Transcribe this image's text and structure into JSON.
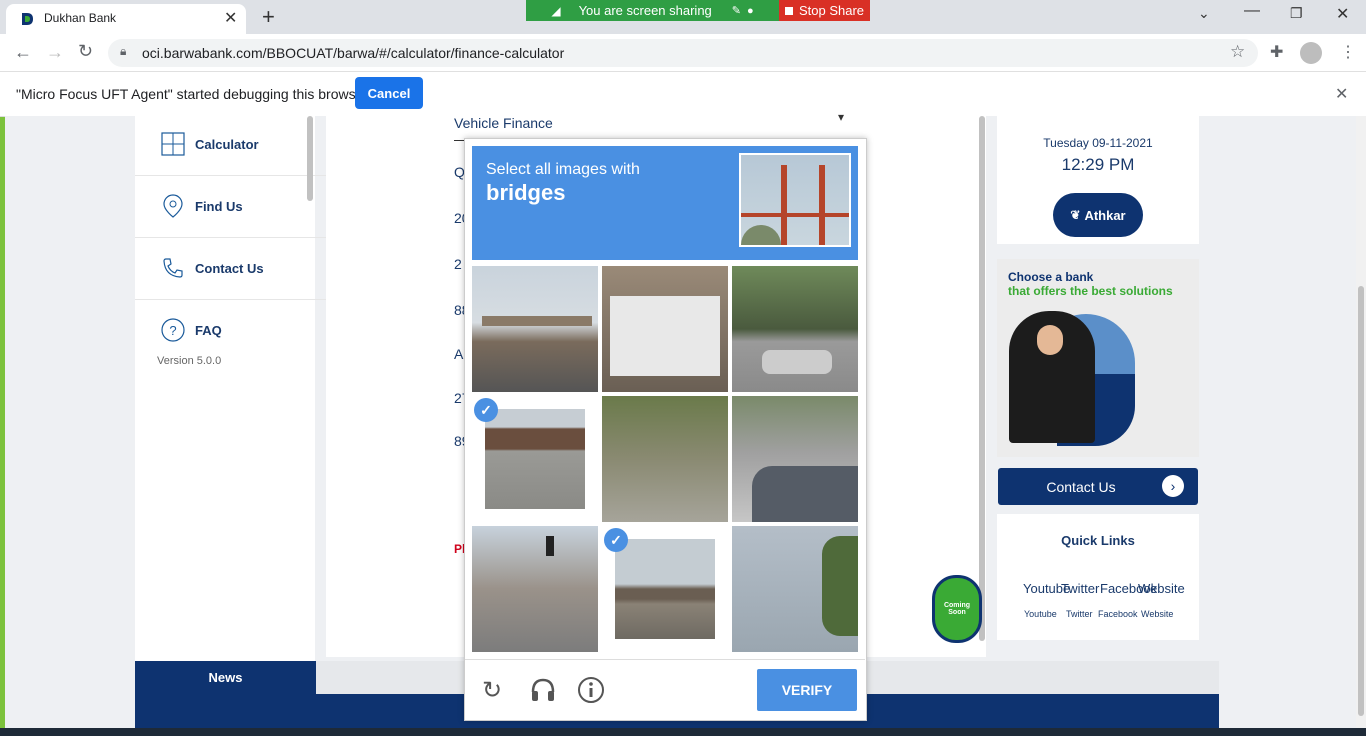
{
  "browser": {
    "tab_title": "Dukhan Bank",
    "url": "oci.barwabank.com/BBOCUAT/barwa/#/calculator/finance-calculator",
    "new_tab": "+"
  },
  "screen_share": {
    "message": "You are screen sharing",
    "stop_label": "Stop Share"
  },
  "infobar": {
    "message": "\"Micro Focus UFT Agent\" started debugging this browser",
    "cancel_label": "Cancel"
  },
  "sidebar": {
    "items": [
      {
        "label": "Calculator"
      },
      {
        "label": "Find Us"
      },
      {
        "label": "Contact Us"
      },
      {
        "label": "FAQ"
      }
    ],
    "version": "Version 5.0.0"
  },
  "form": {
    "finance_type": "Vehicle Finance",
    "partial_values": [
      "Q",
      "20",
      "2",
      "88",
      "A",
      "27",
      "89"
    ],
    "partial_red": "Pl"
  },
  "right_panel": {
    "date": "Tuesday 09-11-2021",
    "time": "12:29 PM",
    "athkar_label": "Athkar",
    "ad_line1": "Choose a bank",
    "ad_line2": "that offers the best solutions",
    "contact_label": "Contact Us",
    "quick_links_title": "Quick Links",
    "links": [
      {
        "alt": "Youtube",
        "label": "Youtube"
      },
      {
        "alt": "Twitter",
        "label": "Twitter"
      },
      {
        "alt": "Facebook",
        "label": "Facebook"
      },
      {
        "alt": "Website",
        "label": "Website"
      }
    ],
    "coming_soon": "Coming Soon"
  },
  "news": {
    "label": "News"
  },
  "captcha": {
    "instruction": "Select all images with",
    "target": "bridges",
    "verify_label": "VERIFY",
    "selected_tiles": [
      3,
      7
    ]
  },
  "colors": {
    "brand_navy": "#0e3370",
    "captcha_blue": "#4a90e2",
    "share_green": "#2f9e44",
    "stop_red": "#d93025",
    "ad_green": "#3aaa35"
  }
}
